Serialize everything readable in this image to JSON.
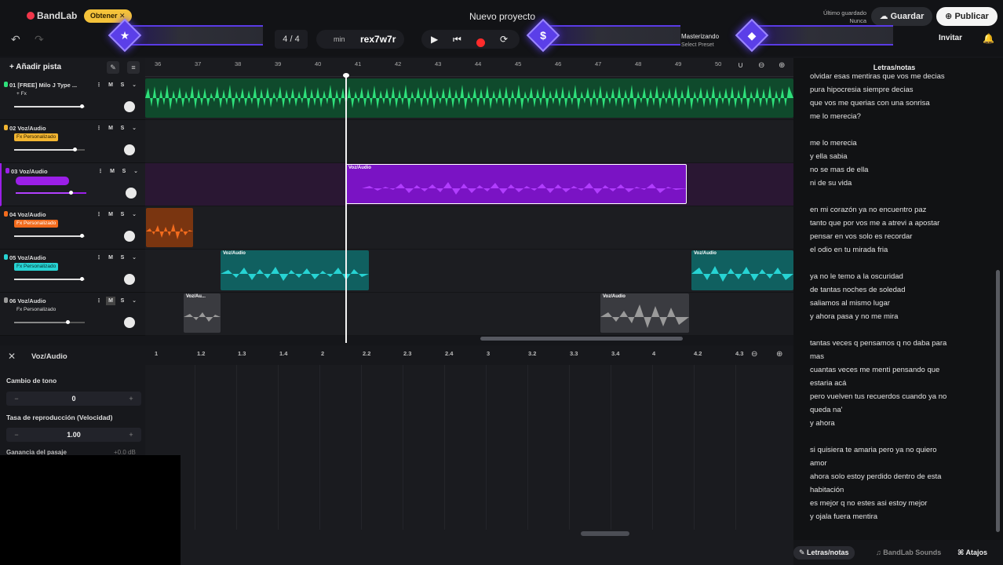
{
  "app": {
    "logo": "BandLab",
    "obtener_label": "Obtener",
    "project_title": "Nuevo proyecto",
    "last_saved_label": "Último guardado",
    "last_saved_value": "Nunca",
    "save_label": "Guardar",
    "publish_label": "Publicar",
    "invite_label": "Invitar"
  },
  "transport": {
    "time_signature": "4 / 4",
    "tempo_unit": "min",
    "key": "rex7w7r",
    "mastering_label": "Masterizando",
    "mastering_preset": "Select Preset"
  },
  "tracks_header": {
    "add_track_label": "Añadir pista"
  },
  "tracks": [
    {
      "name": "01 [FREE] Milo J Type ...",
      "fx": "+ Fx",
      "color": "#2ee07a",
      "fx_bg": "transparent",
      "fx_color": "#ddd",
      "volume": 0.95
    },
    {
      "name": "02 Voz/Audio",
      "fx": "Fx Personalizado",
      "color": "#f2b531",
      "fx_bg": "#f2b531",
      "fx_color": "#2a1d00",
      "volume": 0.85
    },
    {
      "name": "03 Voz/Audio",
      "fx": "",
      "color": "#9b1fe8",
      "fx_bg": "#9b1fe8",
      "fx_color": "#fff",
      "volume": 0.78
    },
    {
      "name": "04 Voz/Audio",
      "fx": "Fx Personalizado",
      "color": "#f26b1d",
      "fx_bg": "#f26b1d",
      "fx_color": "#fff",
      "volume": 0.95
    },
    {
      "name": "05 Voz/Audio",
      "fx": "Fx Personalizado",
      "color": "#27d3d3",
      "fx_bg": "#27d3d3",
      "fx_color": "#063030",
      "volume": 0.95
    },
    {
      "name": "06 Voz/Audio",
      "fx": "Fx Personalizado",
      "color": "#9a9a9a",
      "fx_bg": "transparent",
      "fx_color": "#ddd",
      "volume": 0.75
    }
  ],
  "track_buttons": {
    "mute": "M",
    "solo": "S"
  },
  "timeline": {
    "bars": [
      "36",
      "37",
      "38",
      "39",
      "40",
      "41",
      "42",
      "43",
      "44",
      "45",
      "46",
      "47",
      "48",
      "49",
      "50"
    ]
  },
  "clips": {
    "voz_audio": "Voz/Audio",
    "voz_short": "Voz/Au..."
  },
  "editor": {
    "title": "Voz/Audio",
    "pitch_label": "Cambio de tono",
    "pitch_value": "0",
    "speed_label": "Tasa de reproducción (Velocidad)",
    "speed_value": "1.00",
    "gain_label": "Ganancia del pasaje",
    "gain_value": "+0.0 dB",
    "ruler": [
      "1",
      "1.2",
      "1.3",
      "1.4",
      "2",
      "2.2",
      "2.3",
      "2.4",
      "3",
      "3.2",
      "3.3",
      "3.4",
      "4",
      "4.2",
      "4.3"
    ]
  },
  "lyrics": {
    "title": "Letras/notas",
    "lines": [
      "olvidar esas mentiras que vos me decias",
      "pura hipocresia siempre decias",
      "que vos me querias con una sonrisa",
      "me lo merecia?",
      "",
      "me lo merecia",
      "y ella sabia",
      "no se mas de ella",
      "ni de su vida",
      "",
      " en mi corazón ya no encuentro paz",
      "tanto que por vos me a  atrevi a apostar",
      "pensar en vos solo es recordar",
      "el odio en tu mirada fria",
      "",
      "ya no le temo a la oscuridad",
      "de tantas noches de soledad",
      "saliamos al mismo lugar",
      "y ahora pasa y no me mira",
      "",
      "tantas veces q pensamos q no daba para",
      "mas",
      "cuantas  veces me menti pensando que",
      "estaria acá",
      "pero vuelven tus recuerdos cuando ya no",
      "queda na'",
      "y ahora",
      "",
      "si quisiera te amaria pero ya no quiero",
      "amor",
      "ahora solo estoy perdido dentro de esta",
      "habitación",
      "es mejor q no estes   asi estoy mejor",
      "y ojala fuera mentira"
    ]
  },
  "panel_tabs": {
    "lyrics": "Letras/notas",
    "sounds": "BandLab Sounds",
    "shortcuts": "Atajos"
  }
}
